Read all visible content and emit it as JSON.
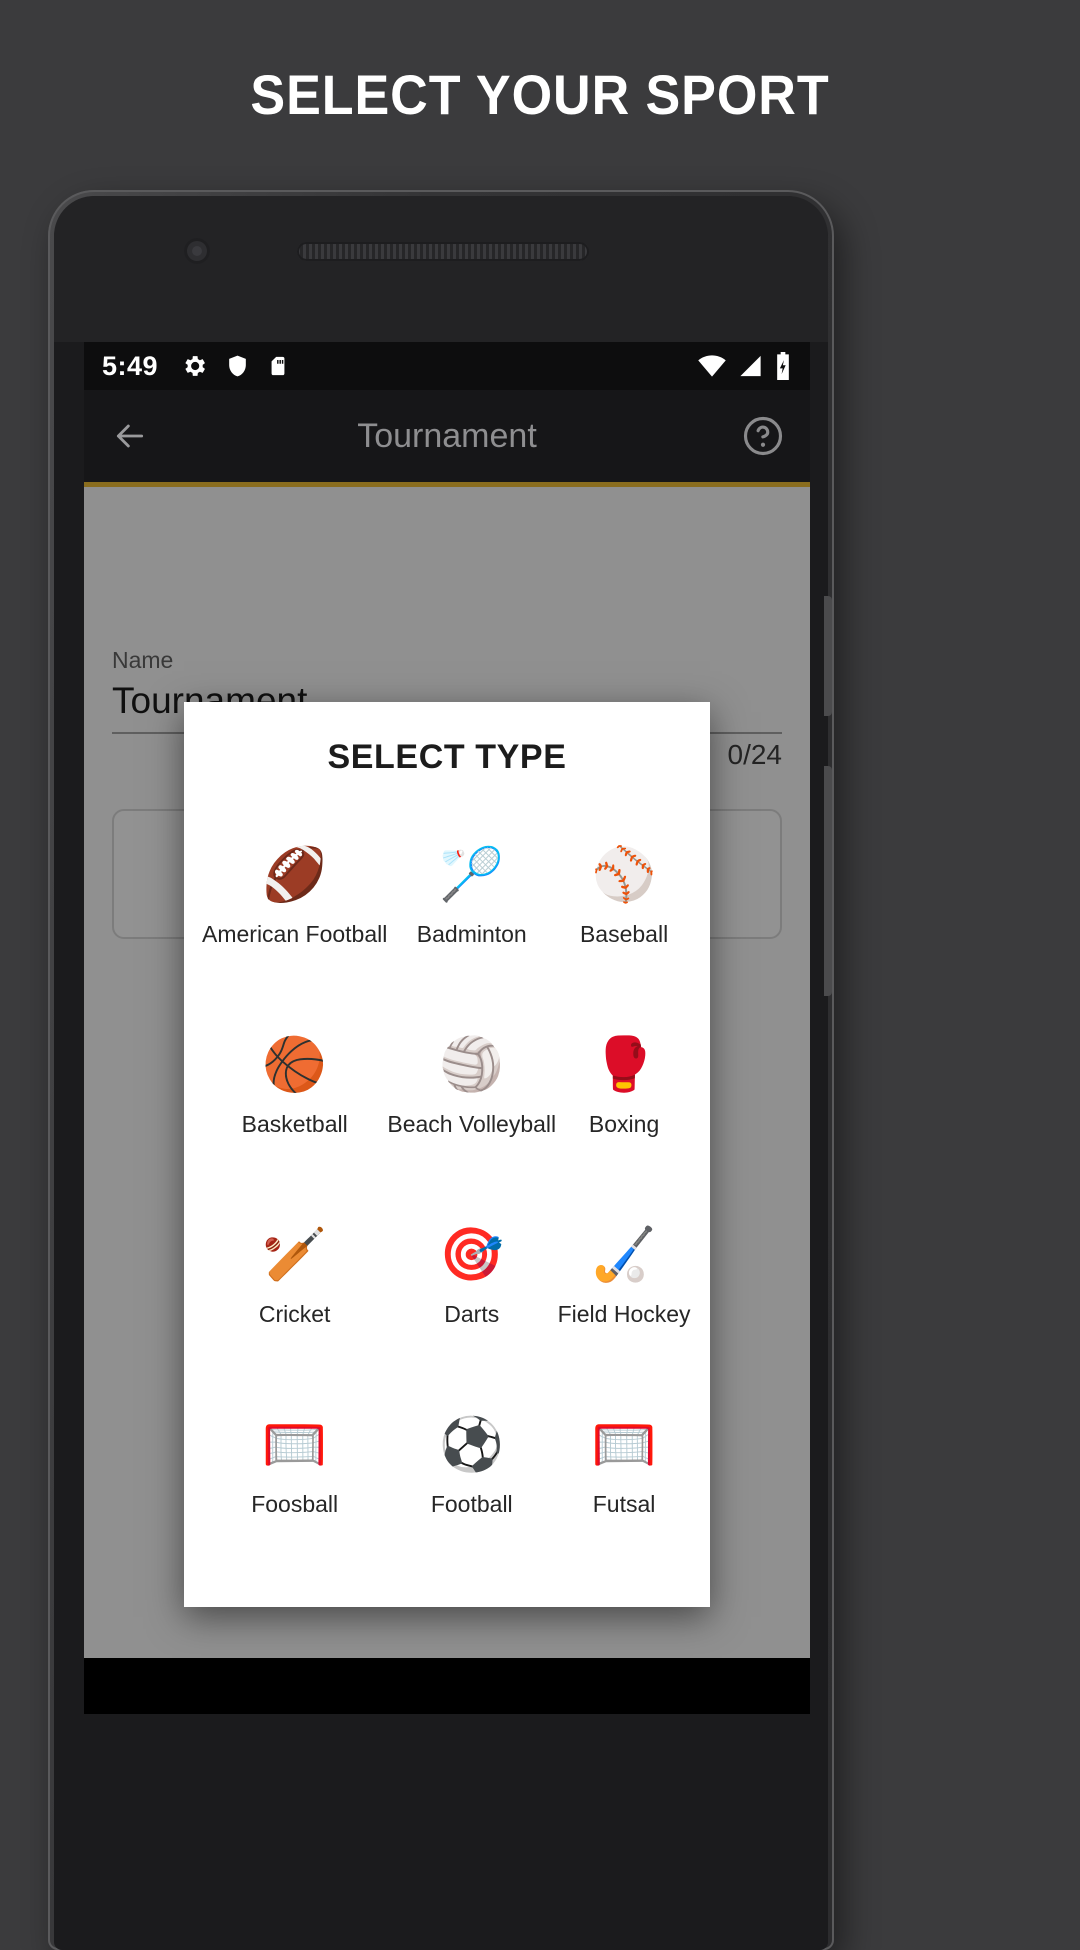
{
  "page": {
    "heading": "SELECT YOUR SPORT"
  },
  "phone": {
    "statusbar": {
      "time": "5:49",
      "left_icons": [
        "gear-icon",
        "shield-icon",
        "sd-card-icon"
      ],
      "right_icons": [
        "wifi-icon",
        "signal-icon",
        "battery-charging-icon"
      ]
    },
    "toolbar": {
      "back_icon": "back-arrow-icon",
      "title": "Tournament",
      "help_icon": "help-circle-icon"
    },
    "background_form": {
      "name_label": "Name",
      "name_value": "Tournament",
      "char_counter": "0/24"
    }
  },
  "dialog": {
    "title": "SELECT TYPE",
    "sports": [
      {
        "label": "American Football",
        "emoji": "🏈",
        "icon": "american-football-icon"
      },
      {
        "label": "Badminton",
        "emoji": "🏸",
        "icon": "badminton-icon"
      },
      {
        "label": "Baseball",
        "emoji": "⚾",
        "icon": "baseball-icon"
      },
      {
        "label": "Basketball",
        "emoji": "🏀",
        "icon": "basketball-icon"
      },
      {
        "label": "Beach Volleyball",
        "emoji": "🏐",
        "icon": "beach-volleyball-icon"
      },
      {
        "label": "Boxing",
        "emoji": "🥊",
        "icon": "boxing-icon"
      },
      {
        "label": "Cricket",
        "emoji": "🏏",
        "icon": "cricket-icon"
      },
      {
        "label": "Darts",
        "emoji": "🎯",
        "icon": "darts-icon"
      },
      {
        "label": "Field Hockey",
        "emoji": "🏑",
        "icon": "field-hockey-icon"
      },
      {
        "label": "Foosball",
        "emoji": "🥅",
        "icon": "foosball-icon"
      },
      {
        "label": "Football",
        "emoji": "⚽",
        "icon": "football-icon"
      },
      {
        "label": "Futsal",
        "emoji": "🥅",
        "icon": "futsal-icon"
      }
    ]
  },
  "colors": {
    "page_background": "#3b3b3d",
    "accent": "#8a6d1e",
    "dialog_background": "#ffffff",
    "toolbar_background": "#161618",
    "statusbar_background": "#0d0d0e"
  }
}
